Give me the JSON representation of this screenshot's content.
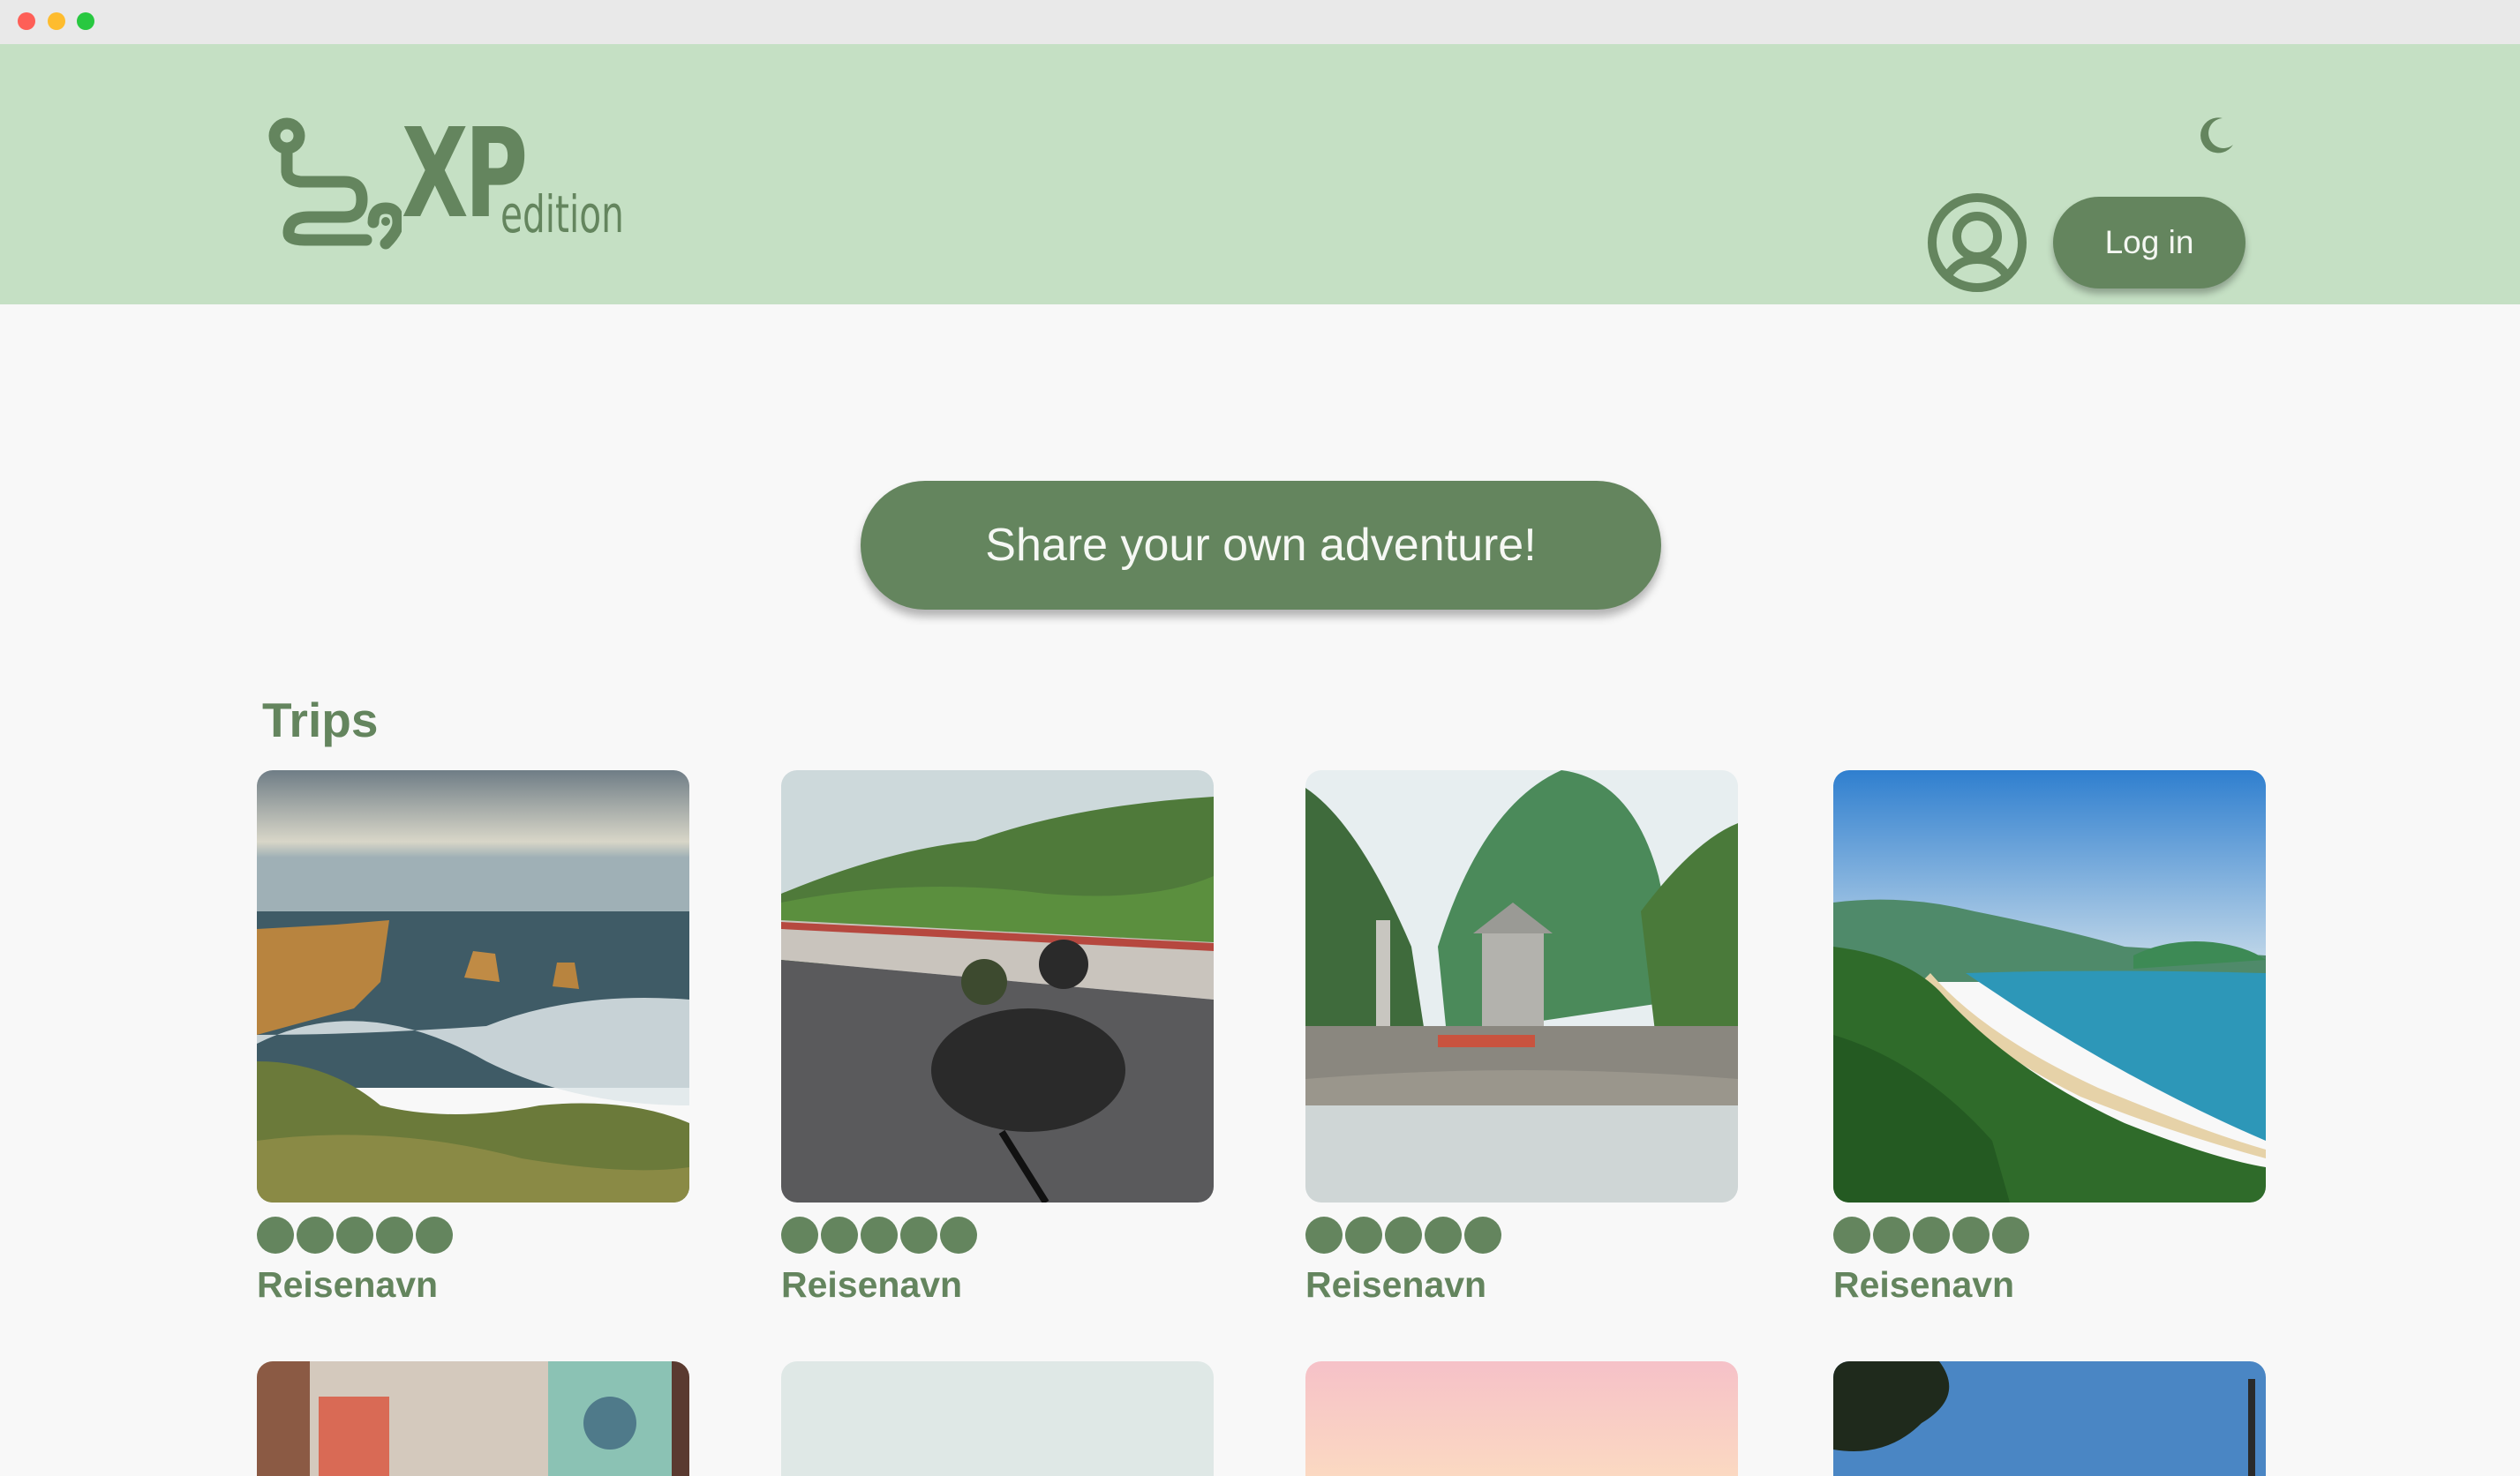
{
  "window": {
    "controls": [
      "close",
      "minimize",
      "zoom"
    ]
  },
  "header": {
    "logo_main": "XP",
    "logo_sub": "edition",
    "theme_toggle_icon": "moon-icon",
    "profile_icon": "user-circle-icon",
    "login_label": "Log in"
  },
  "hero": {
    "share_label": "Share your own adventure!"
  },
  "trips": {
    "title": "Trips",
    "cards": [
      {
        "name": "Reisenavn",
        "rating": 5,
        "image": "coastal cliffs and sea stacks"
      },
      {
        "name": "Reisenavn",
        "rating": 5,
        "image": "scooter riders on mountain road"
      },
      {
        "name": "Reisenavn",
        "rating": 5,
        "image": "temple gate below karst mountains"
      },
      {
        "name": "Reisenavn",
        "rating": 5,
        "image": "green hills over a beach bay"
      }
    ],
    "next_row_images": [
      "street with clock tower sign",
      "misty sky",
      "pink sunset sky",
      "blue sky with tree"
    ]
  },
  "colors": {
    "accent": "#64855e",
    "header_bg": "#c5e0c4",
    "page_bg": "#f8f8f8"
  }
}
